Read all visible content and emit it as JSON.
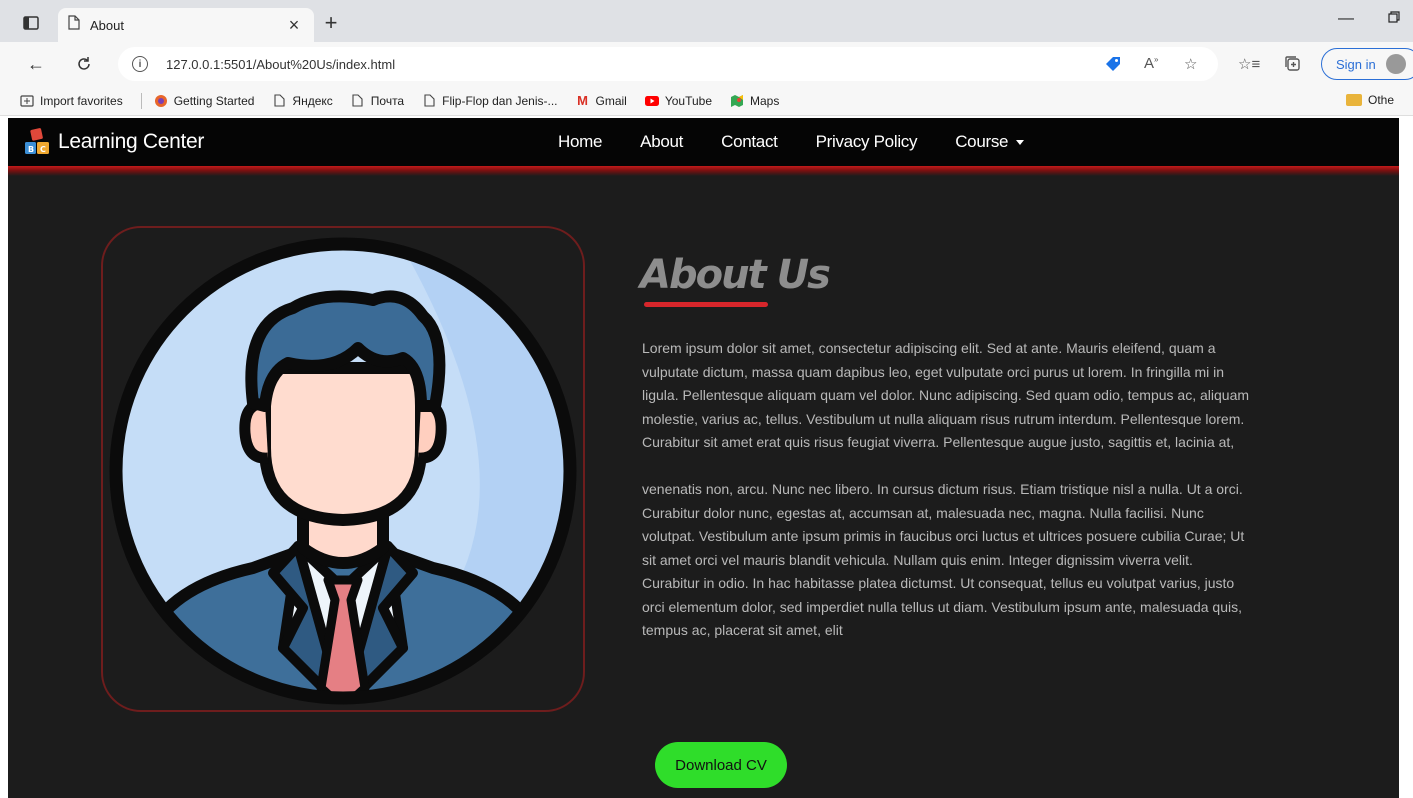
{
  "browser": {
    "tab_title": "About",
    "url": "127.0.0.1:5501/About%20Us/index.html",
    "signin_label": "Sign in",
    "favorites": [
      "Import favorites",
      "Getting Started",
      "Яндекс",
      "Почта",
      "Flip-Flop dan Jenis-...",
      "Gmail",
      "YouTube",
      "Maps"
    ],
    "other_favorites": "Othe"
  },
  "site": {
    "brand": "Learning Center",
    "nav": [
      "Home",
      "About",
      "Contact",
      "Privacy Policy",
      "Course"
    ]
  },
  "about": {
    "title": "About Us",
    "paragraphs": [
      "Lorem ipsum dolor sit amet, consectetur adipiscing elit. Sed at ante. Mauris eleifend, quam a vulputate dictum, massa quam dapibus leo, eget vulputate orci purus ut lorem. In fringilla mi in ligula. Pellentesque aliquam quam vel dolor. Nunc adipiscing. Sed quam odio, tempus ac, aliquam molestie, varius ac, tellus. Vestibulum ut nulla aliquam risus rutrum interdum. Pellentesque lorem. Curabitur sit amet erat quis risus feugiat viverra. Pellentesque augue justo, sagittis et, lacinia at,",
      "venenatis non, arcu. Nunc nec libero. In cursus dictum risus. Etiam tristique nisl a nulla. Ut a orci. Curabitur dolor nunc, egestas at, accumsan at, malesuada nec, magna. Nulla facilisi. Nunc volutpat. Vestibulum ante ipsum primis in faucibus orci luctus et ultrices posuere cubilia Curae; Ut sit amet orci vel mauris blandit vehicula. Nullam quis enim. Integer dignissim viverra velit. Curabitur in odio. In hac habitasse platea dictumst. Ut consequat, tellus eu volutpat varius, justo orci elementum dolor, sed imperdiet nulla tellus ut diam. Vestibulum ipsum ante, malesuada quis, tempus ac, placerat sit amet, elit"
    ],
    "cv_button": "Download CV"
  },
  "colors": {
    "accent_red": "#d7262b",
    "cv_green": "#2fdd2a",
    "page_bg": "#1c1c1c"
  }
}
